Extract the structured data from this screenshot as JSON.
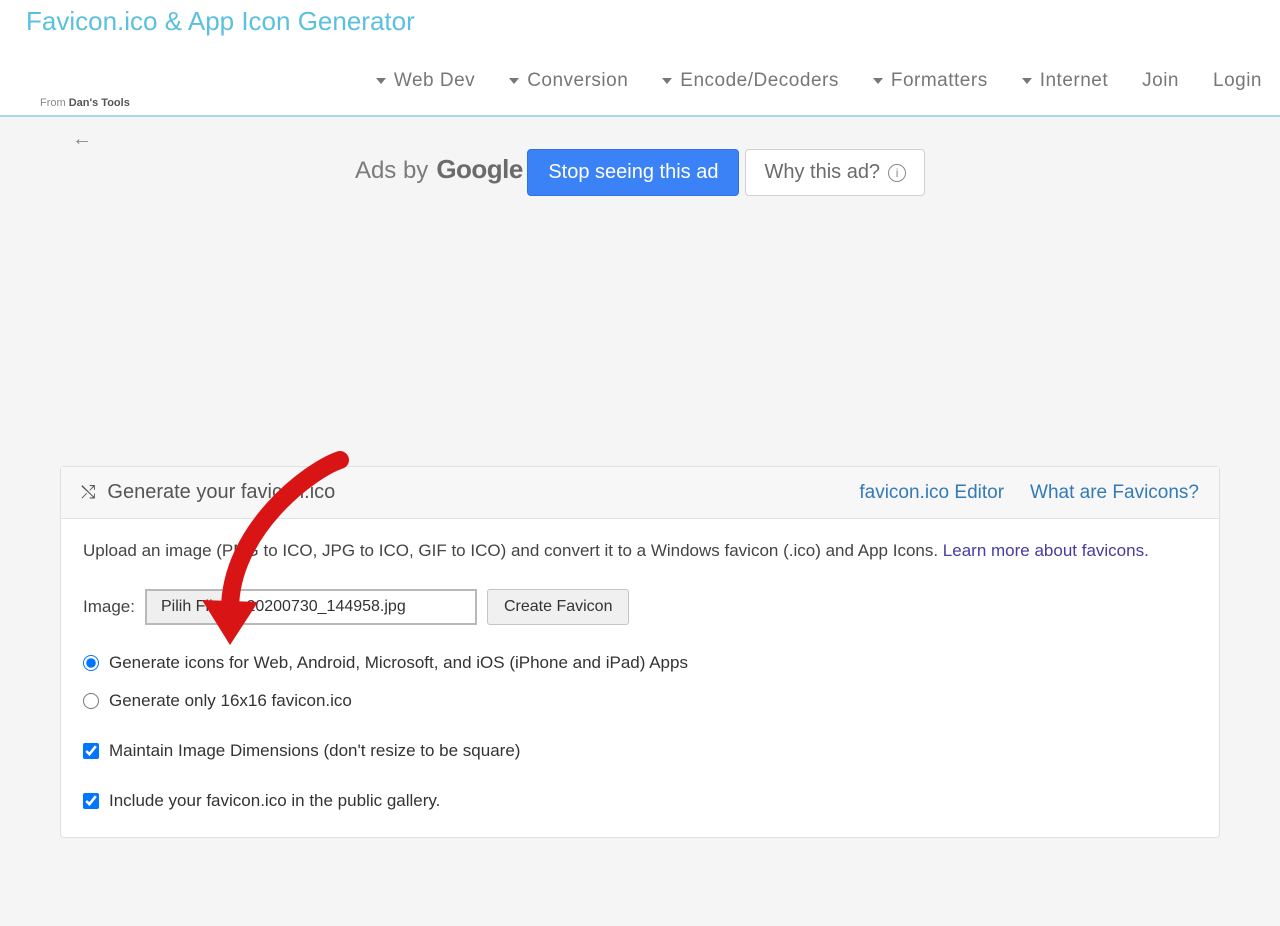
{
  "header": {
    "title": "Favicon.ico & App Icon Generator",
    "from_prefix": "From ",
    "from_source": "Dan's Tools"
  },
  "nav": {
    "webdev": "Web Dev",
    "conversion": "Conversion",
    "encode": "Encode/Decoders",
    "formatters": "Formatters",
    "internet": "Internet",
    "join": "Join",
    "login": "Login"
  },
  "ads": {
    "label": "Ads by",
    "brand": "Google",
    "stop": "Stop seeing this ad",
    "why": "Why this ad?"
  },
  "panel": {
    "title": "Generate your favicon.ico",
    "link_editor": "favicon.ico Editor",
    "link_what": "What are Favicons?",
    "desc_pre": "Upload an image (PNG to ICO, JPG to ICO, GIF to ICO) and convert it to a Windows favicon (.ico) and App Icons. ",
    "desc_link": "Learn more about favicons.",
    "image_label": "Image:",
    "file_button": "Pilih File",
    "file_name": "20200730_144958.jpg",
    "create_btn": "Create Favicon",
    "opt_full": "Generate icons for Web, Android, Microsoft, and iOS (iPhone and iPad) Apps",
    "opt_16": "Generate only 16x16 favicon.ico",
    "opt_maintain": "Maintain Image Dimensions (don't resize to be square)",
    "opt_gallery": "Include your favicon.ico in the public gallery."
  }
}
